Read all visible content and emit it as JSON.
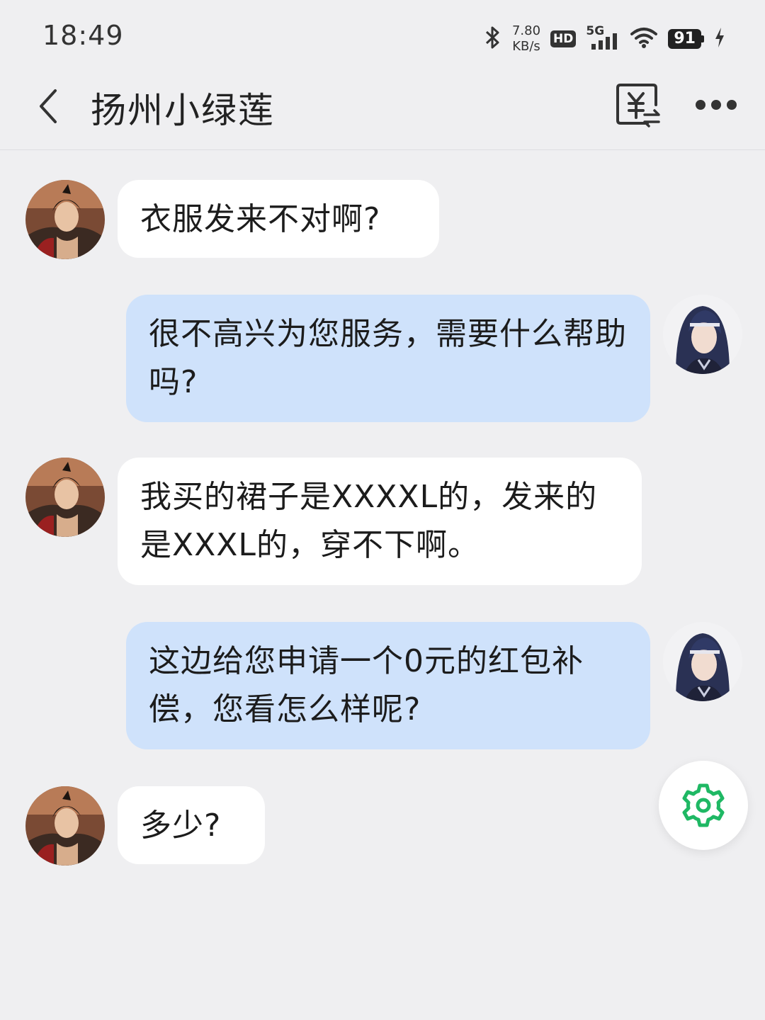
{
  "status_bar": {
    "time": "18:49",
    "net_speed_value": "7.80",
    "net_speed_unit": "KB/s",
    "hd_label": "HD",
    "signal_label": "5G",
    "battery_level": "91"
  },
  "header": {
    "title": "扬州小绿莲"
  },
  "messages": [
    {
      "side": "left",
      "text": "衣服发来不对啊?"
    },
    {
      "side": "right",
      "text": "很不高兴为您服务，需要什么帮助吗?"
    },
    {
      "side": "left",
      "text": "我买的裙子是XXXXL的，发来的是XXXL的，穿不下啊。"
    },
    {
      "side": "right",
      "text": "这边给您申请一个0元的红包补偿，您看怎么样呢?"
    },
    {
      "side": "left",
      "text": "多少?"
    }
  ],
  "colors": {
    "background": "#efeff1",
    "incoming_bubble": "#ffffff",
    "outgoing_bubble": "#cfe2fb",
    "settings_accent": "#1fb864"
  }
}
